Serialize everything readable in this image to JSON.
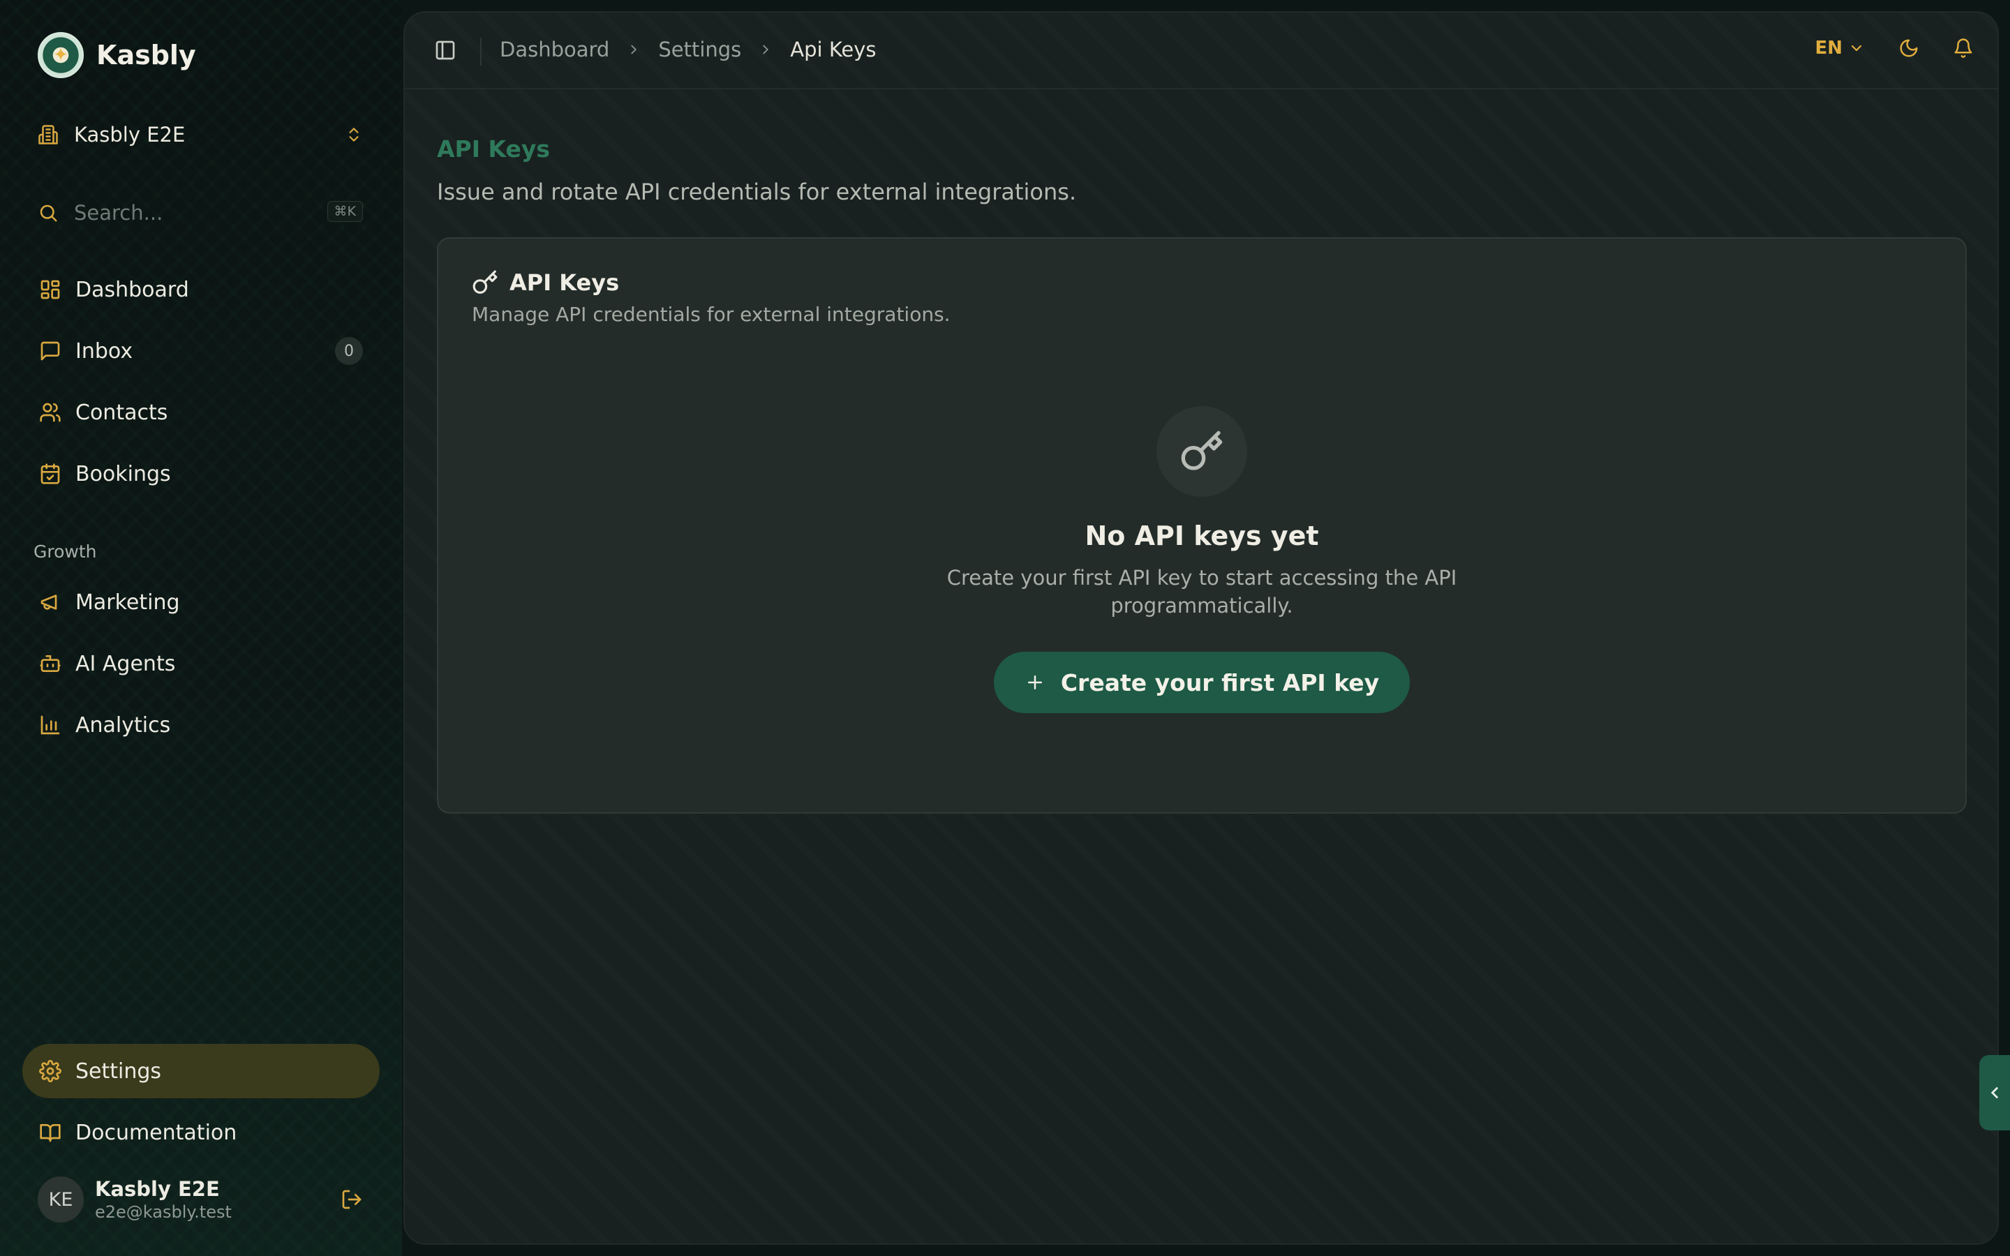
{
  "brand": {
    "name": "Kasbly"
  },
  "workspace": {
    "name": "Kasbly E2E"
  },
  "search": {
    "placeholder": "Search...",
    "shortcut": "⌘K"
  },
  "nav": {
    "main": [
      {
        "label": "Dashboard",
        "icon": "layout-dashboard-icon"
      },
      {
        "label": "Inbox",
        "icon": "message-square-icon",
        "count": "0"
      },
      {
        "label": "Contacts",
        "icon": "users-icon"
      },
      {
        "label": "Bookings",
        "icon": "calendar-check-icon"
      }
    ],
    "growth_label": "Growth",
    "growth": [
      {
        "label": "Marketing",
        "icon": "megaphone-icon"
      },
      {
        "label": "AI Agents",
        "icon": "bot-icon"
      },
      {
        "label": "Analytics",
        "icon": "bar-chart-icon"
      }
    ],
    "bottom": [
      {
        "label": "Settings",
        "icon": "gear-icon",
        "active": true
      },
      {
        "label": "Documentation",
        "icon": "book-open-icon"
      }
    ]
  },
  "user": {
    "initials": "KE",
    "name": "Kasbly E2E",
    "email": "e2e@kasbly.test"
  },
  "topbar": {
    "breadcrumbs": [
      "Dashboard",
      "Settings",
      "Api Keys"
    ],
    "language": "EN"
  },
  "page": {
    "title": "API Keys",
    "description": "Issue and rotate API credentials for external integrations."
  },
  "card": {
    "title": "API Keys",
    "description": "Manage API credentials for external integrations.",
    "empty": {
      "title": "No API keys yet",
      "description": "Create your first API key to start accessing the API programmatically.",
      "cta": "Create your first API key"
    }
  },
  "colors": {
    "accent_gold": "#d9a840",
    "brand_green": "#1e5a46",
    "title_green": "#2f7a5c",
    "active_nav_bg": "#3a3a1c"
  }
}
